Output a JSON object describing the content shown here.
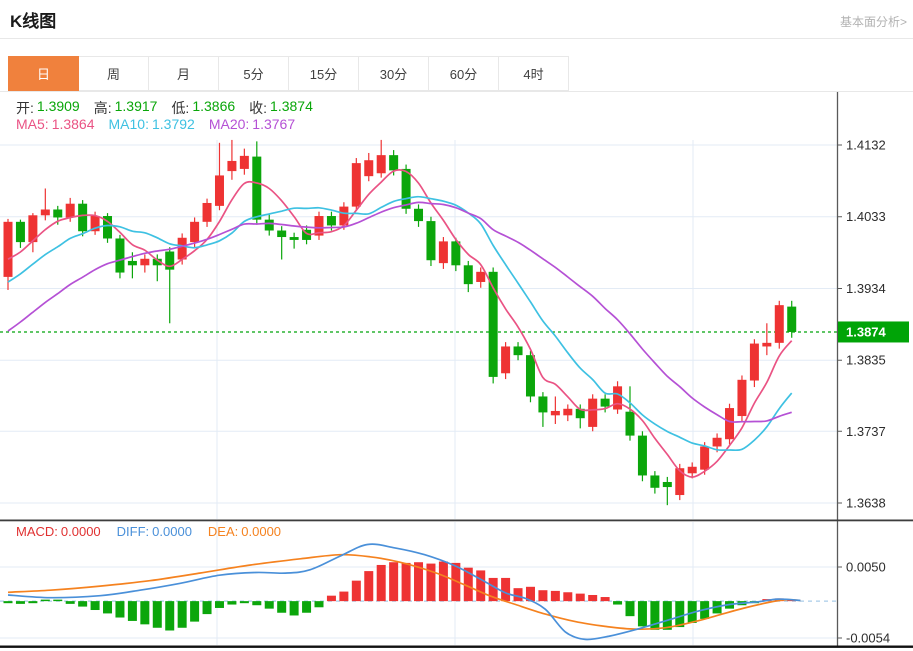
{
  "header": {
    "title": "K线图",
    "link": "基本面分析>"
  },
  "tabs": [
    {
      "label": "日",
      "active": true
    },
    {
      "label": "周",
      "active": false
    },
    {
      "label": "月",
      "active": false
    },
    {
      "label": "5分",
      "active": false
    },
    {
      "label": "15分",
      "active": false
    },
    {
      "label": "30分",
      "active": false
    },
    {
      "label": "60分",
      "active": false
    },
    {
      "label": "4时",
      "active": false
    }
  ],
  "legend": {
    "ohlc": [
      {
        "label": "开:",
        "value": "1.3909"
      },
      {
        "label": "高:",
        "value": "1.3917"
      },
      {
        "label": "低:",
        "value": "1.3866"
      },
      {
        "label": "收:",
        "value": "1.3874"
      }
    ],
    "ma": [
      {
        "label": "MA5:",
        "value": "1.3864"
      },
      {
        "label": "MA10:",
        "value": "1.3792"
      },
      {
        "label": "MA20:",
        "value": "1.3767"
      }
    ]
  },
  "macd_legend": [
    {
      "label": "MACD:",
      "value": "0.0000"
    },
    {
      "label": "DIFF:",
      "value": "0.0000"
    },
    {
      "label": "DEA:",
      "value": "0.0000"
    }
  ],
  "colors": {
    "up": "#ee3333",
    "down": "#0ba60b",
    "badge": "#00a407",
    "dotted_price": "#00a50a",
    "ohlc_value": "#09a609",
    "ma5": "#ea5384",
    "ma10": "#3ec1e2",
    "ma20": "#b551d5",
    "macd": "#e03131",
    "diff": "#4a90d9",
    "dea": "#f5821f",
    "grid": "#e3ebf5",
    "zero_dash": "#a9cce9",
    "axis_line": "#595959",
    "tick_text": "#2d2d2d"
  },
  "chart_data": {
    "type": "candlestick",
    "title": "K线图",
    "price_ticks": [
      1.4132,
      1.4033,
      1.3934,
      1.3835,
      1.3737,
      1.3638
    ],
    "last_price": 1.3874,
    "macd_ticks": [
      0.005,
      -0.0054
    ],
    "ma_periods": [
      5,
      10,
      20
    ],
    "prehistory_closes": [
      1.375,
      1.3762,
      1.3775,
      1.3788,
      1.38,
      1.3812,
      1.3825,
      1.384,
      1.3855,
      1.387,
      1.3885,
      1.39,
      1.3912,
      1.3924,
      1.3936,
      1.3948,
      1.3958,
      1.3966,
      1.3974
    ],
    "candles": [
      [
        1.395,
        1.4026,
        1.3932,
        1.403
      ],
      [
        1.4026,
        1.3998,
        1.399,
        1.4029
      ],
      [
        1.3998,
        1.4035,
        1.3984,
        1.4038
      ],
      [
        1.4035,
        1.4043,
        1.4028,
        1.4072
      ],
      [
        1.4043,
        1.4032,
        1.4022,
        1.4048
      ],
      [
        1.4032,
        1.4051,
        1.4026,
        1.4059
      ],
      [
        1.4051,
        1.4013,
        1.4006,
        1.4056
      ],
      [
        1.4013,
        1.4034,
        1.4008,
        1.404
      ],
      [
        1.4034,
        1.4003,
        1.3997,
        1.4038
      ],
      [
        1.4003,
        1.3956,
        1.3948,
        1.4008
      ],
      [
        1.3972,
        1.3966,
        1.3948,
        1.3984
      ],
      [
        1.3966,
        1.3975,
        1.3956,
        1.3981
      ],
      [
        1.3975,
        1.3966,
        1.3944,
        1.3981
      ],
      [
        1.3985,
        1.396,
        1.3886,
        1.3991
      ],
      [
        1.3974,
        1.4004,
        1.3967,
        1.401
      ],
      [
        1.3998,
        1.4026,
        1.3991,
        1.4032
      ],
      [
        1.4026,
        1.4052,
        1.4019,
        1.4058
      ],
      [
        1.4048,
        1.409,
        1.4042,
        1.4135
      ],
      [
        1.4096,
        1.411,
        1.4084,
        1.4139
      ],
      [
        1.4099,
        1.4117,
        1.4091,
        1.4127
      ],
      [
        1.4116,
        1.4029,
        1.4022,
        1.4137
      ],
      [
        1.4029,
        1.4014,
        1.4007,
        1.4036
      ],
      [
        1.4014,
        1.4005,
        1.3974,
        1.402
      ],
      [
        1.4005,
        1.4001,
        1.3989,
        1.4011
      ],
      [
        1.4015,
        1.4001,
        1.3995,
        1.4021
      ],
      [
        1.4007,
        1.4034,
        1.4001,
        1.404
      ],
      [
        1.4034,
        1.4021,
        1.4014,
        1.404
      ],
      [
        1.4021,
        1.4047,
        1.4015,
        1.4053
      ],
      [
        1.4047,
        1.4107,
        1.4041,
        1.4114
      ],
      [
        1.4089,
        1.4111,
        1.4082,
        1.4121
      ],
      [
        1.4093,
        1.4118,
        1.4087,
        1.4139
      ],
      [
        1.4118,
        1.4097,
        1.409,
        1.4125
      ],
      [
        1.4099,
        1.4044,
        1.4037,
        1.4105
      ],
      [
        1.4044,
        1.4027,
        1.4019,
        1.405
      ],
      [
        1.4027,
        1.3973,
        1.3965,
        1.4033
      ],
      [
        1.3969,
        1.3999,
        1.3961,
        1.4005
      ],
      [
        1.3999,
        1.3966,
        1.3958,
        1.4004
      ],
      [
        1.3966,
        1.394,
        1.3929,
        1.3972
      ],
      [
        1.3943,
        1.3957,
        1.3935,
        1.3963
      ],
      [
        1.3957,
        1.3812,
        1.3803,
        1.3963
      ],
      [
        1.3817,
        1.3854,
        1.3809,
        1.386
      ],
      [
        1.3854,
        1.3842,
        1.3835,
        1.386
      ],
      [
        1.3842,
        1.3785,
        1.3777,
        1.3848
      ],
      [
        1.3785,
        1.3763,
        1.3743,
        1.3791
      ],
      [
        1.3759,
        1.3765,
        1.3747,
        1.3785
      ],
      [
        1.3759,
        1.3768,
        1.3751,
        1.3774
      ],
      [
        1.3768,
        1.3755,
        1.3741,
        1.3774
      ],
      [
        1.3743,
        1.3782,
        1.3737,
        1.3788
      ],
      [
        1.3782,
        1.3771,
        1.3763,
        1.3788
      ],
      [
        1.3767,
        1.3799,
        1.3761,
        1.3806
      ],
      [
        1.3764,
        1.3731,
        1.3724,
        1.3799
      ],
      [
        1.3731,
        1.3676,
        1.3668,
        1.3737
      ],
      [
        1.3676,
        1.3659,
        1.3651,
        1.3682
      ],
      [
        1.3667,
        1.366,
        1.3635,
        1.3674
      ],
      [
        1.3649,
        1.3686,
        1.3642,
        1.3692
      ],
      [
        1.3679,
        1.3688,
        1.3672,
        1.3694
      ],
      [
        1.3684,
        1.3716,
        1.3677,
        1.3722
      ],
      [
        1.3716,
        1.3728,
        1.3708,
        1.3734
      ],
      [
        1.3726,
        1.3769,
        1.3719,
        1.3775
      ],
      [
        1.3758,
        1.3808,
        1.375,
        1.3814
      ],
      [
        1.3807,
        1.3858,
        1.3798,
        1.3864
      ],
      [
        1.3854,
        1.3859,
        1.3842,
        1.3886
      ],
      [
        1.3859,
        1.3911,
        1.3851,
        1.3917
      ],
      [
        1.3909,
        1.3874,
        1.3866,
        1.3917
      ]
    ],
    "macd_hist": [
      -0.0003,
      -0.0004,
      -0.0003,
      -0.0002,
      -0.0002,
      -0.0004,
      -0.0008,
      -0.0013,
      -0.0018,
      -0.0024,
      -0.0029,
      -0.0034,
      -0.0039,
      -0.0043,
      -0.0039,
      -0.003,
      -0.0019,
      -0.001,
      -0.0005,
      -0.0003,
      -0.0006,
      -0.0011,
      -0.0017,
      -0.0021,
      -0.0017,
      -0.0009,
      0.0008,
      0.0014,
      0.003,
      0.0044,
      0.0053,
      0.0057,
      0.0056,
      0.0057,
      0.0055,
      0.0058,
      0.0056,
      0.0049,
      0.0045,
      0.0034,
      0.0034,
      0.0019,
      0.0021,
      0.0016,
      0.0015,
      0.0013,
      0.0011,
      0.0009,
      0.0006,
      -0.0005,
      -0.0022,
      -0.0037,
      -0.0042,
      -0.0042,
      -0.0038,
      -0.0032,
      -0.0026,
      -0.0018,
      -0.0011,
      -0.0006,
      -0.0003,
      0.0003,
      0.0004,
      0.0001
    ],
    "diff_line": [
      [
        0,
        0.0009
      ],
      [
        3.4,
        0.0005
      ],
      [
        7.4,
        0.0008
      ],
      [
        10.6,
        0.0016
      ],
      [
        13.8,
        0.0026
      ],
      [
        17,
        0.0038
      ],
      [
        19.9,
        0.0042
      ],
      [
        22.3,
        0.0041
      ],
      [
        24.3,
        0.0046
      ],
      [
        26.7,
        0.0066
      ],
      [
        28.9,
        0.0083
      ],
      [
        31.1,
        0.0078
      ],
      [
        33.5,
        0.0068
      ],
      [
        35.9,
        0.0052
      ],
      [
        37.9,
        0.0033
      ],
      [
        40,
        0.0012
      ],
      [
        41.6,
        0.0004
      ],
      [
        43.2,
        -0.0012
      ],
      [
        44.8,
        -0.0045
      ],
      [
        46.4,
        -0.0056
      ],
      [
        48.4,
        -0.0051
      ],
      [
        50.8,
        -0.004
      ],
      [
        53.2,
        -0.0027
      ],
      [
        55.6,
        -0.0014
      ],
      [
        58,
        -0.0005
      ],
      [
        60.3,
        -0.0001
      ],
      [
        61.9,
        0.0003
      ],
      [
        63.7,
        0.0001
      ]
    ],
    "dea_line": [
      [
        0,
        0.0013
      ],
      [
        3.4,
        0.0016
      ],
      [
        7.4,
        0.0022
      ],
      [
        11.4,
        0.003
      ],
      [
        15.4,
        0.0041
      ],
      [
        19.5,
        0.0053
      ],
      [
        23.5,
        0.0062
      ],
      [
        26.7,
        0.0068
      ],
      [
        29.1,
        0.0065
      ],
      [
        31.5,
        0.0057
      ],
      [
        34.3,
        0.0042
      ],
      [
        36.7,
        0.0024
      ],
      [
        38.7,
        0.0008
      ],
      [
        40.8,
        -0.0005
      ],
      [
        43.2,
        -0.0019
      ],
      [
        45.6,
        -0.003
      ],
      [
        48,
        -0.0037
      ],
      [
        50.4,
        -0.0041
      ],
      [
        52.8,
        -0.0039
      ],
      [
        55.2,
        -0.003
      ],
      [
        57.2,
        -0.002
      ],
      [
        59.2,
        -0.001
      ],
      [
        61.1,
        -0.0002
      ],
      [
        62.5,
        0.0002
      ],
      [
        63.7,
        0.0001
      ]
    ]
  }
}
